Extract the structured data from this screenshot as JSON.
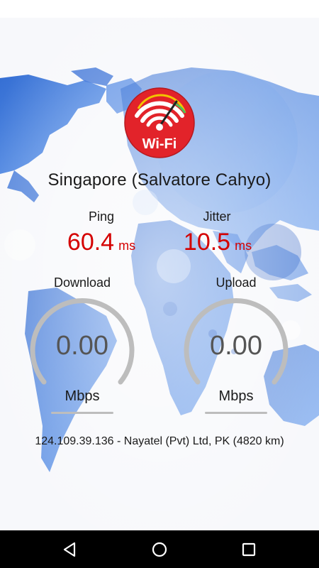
{
  "server": {
    "name": "Singapore (Salvatore Cahyo)"
  },
  "ping": {
    "label": "Ping",
    "value": "60.4",
    "unit": "ms"
  },
  "jitter": {
    "label": "Jitter",
    "value": "10.5",
    "unit": "ms"
  },
  "download": {
    "label": "Download",
    "value": "0.00",
    "unit": "Mbps",
    "fraction": 0
  },
  "upload": {
    "label": "Upload",
    "value": "0.00",
    "unit": "Mbps",
    "fraction": 0
  },
  "isp": {
    "text": "124.109.39.136 - Nayatel (Pvt) Ltd, PK (4820 km)"
  },
  "logo": {
    "text": "Wi-Fi",
    "icon": "wifi-speedometer-icon"
  },
  "colors": {
    "accent": "#d40000",
    "logo_red": "#e2232a",
    "gauge_track": "#bdbdbd",
    "map_blue": "#2e6fd6"
  },
  "nav": {
    "back_icon": "back-triangle-icon",
    "home_icon": "home-circle-icon",
    "recents_icon": "recents-square-icon"
  }
}
